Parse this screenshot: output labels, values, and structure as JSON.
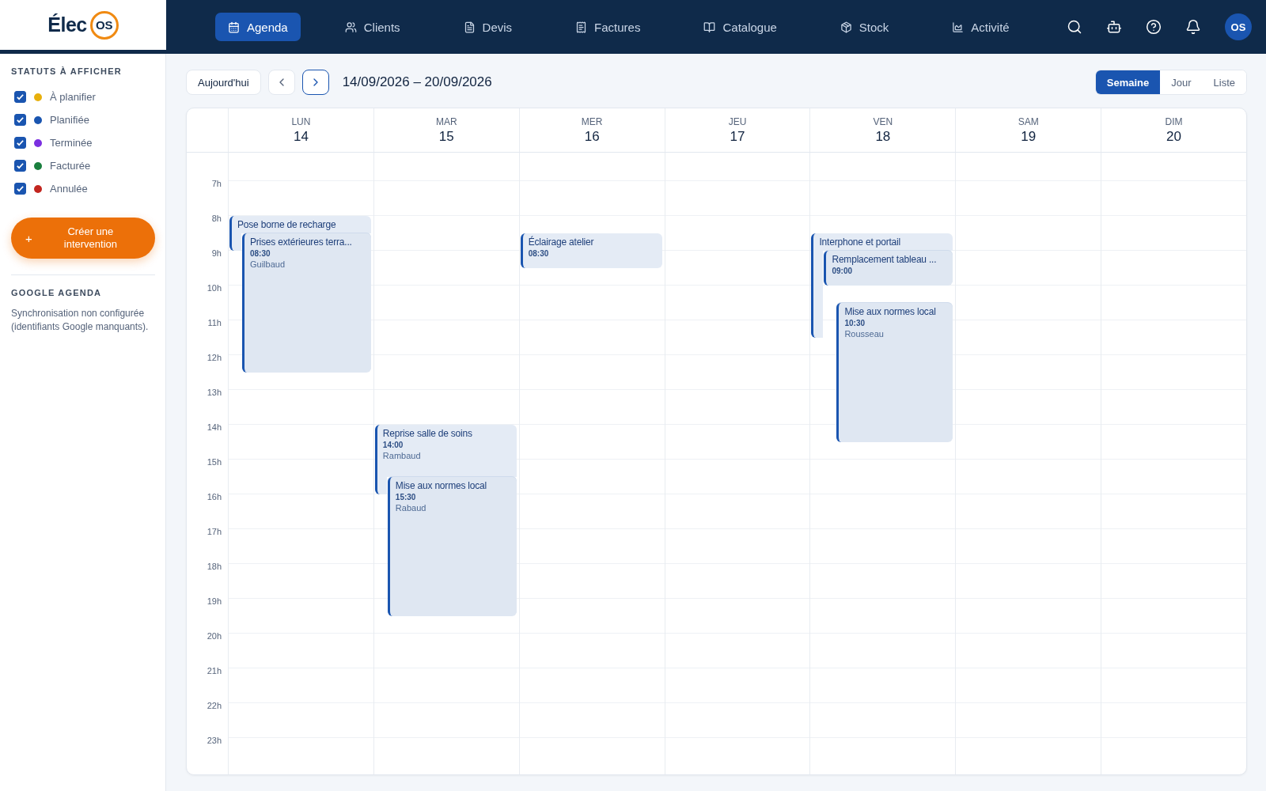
{
  "logo": {
    "text": "Élec",
    "badge": "OS"
  },
  "nav": [
    {
      "label": "Agenda",
      "selected": true
    },
    {
      "label": "Clients",
      "selected": false
    },
    {
      "label": "Devis",
      "selected": false
    },
    {
      "label": "Factures",
      "selected": false
    },
    {
      "label": "Catalogue",
      "selected": false
    },
    {
      "label": "Stock",
      "selected": false
    },
    {
      "label": "Activité",
      "selected": false
    }
  ],
  "avatar": "OS",
  "sidebar": {
    "statuses_title": "STATUTS À AFFICHER",
    "statuses": [
      {
        "label": "À planifier",
        "color": "#e8b00c",
        "checked": true
      },
      {
        "label": "Planifiée",
        "color": "#1a55b0",
        "checked": true
      },
      {
        "label": "Terminée",
        "color": "#7b2fe0",
        "checked": true
      },
      {
        "label": "Facturée",
        "color": "#1a7f3e",
        "checked": true
      },
      {
        "label": "Annulée",
        "color": "#c2261f",
        "checked": true
      }
    ],
    "create_button": {
      "icon": "+",
      "label": "Créer une intervention"
    },
    "google_title": "GOOGLE AGENDA",
    "google_text": "Synchronisation non configurée (identifiants Google manquants)."
  },
  "toolbar": {
    "today": "Aujourd'hui",
    "range": "14/09/2026 – 20/09/2026",
    "views": [
      {
        "label": "Semaine",
        "selected": true
      },
      {
        "label": "Jour",
        "selected": false
      },
      {
        "label": "Liste",
        "selected": false
      }
    ]
  },
  "calendar": {
    "hours": [
      "7h",
      "8h",
      "9h",
      "10h",
      "11h",
      "12h",
      "13h",
      "14h",
      "15h",
      "16h",
      "17h",
      "18h",
      "19h",
      "20h",
      "21h",
      "22h",
      "23h"
    ],
    "days": [
      {
        "name": "LUN",
        "date": "14",
        "events": [
          {
            "title": "Pose borne de recharge"
          },
          {
            "title": "Prises extérieures terra...",
            "time": "08:30",
            "person": "Guilbaud"
          }
        ]
      },
      {
        "name": "MAR",
        "date": "15",
        "events": [
          {
            "title": "Reprise salle de soins",
            "time": "14:00",
            "person": "Rambaud"
          },
          {
            "title": "Mise aux normes local",
            "time": "15:30",
            "person": "Rabaud"
          }
        ]
      },
      {
        "name": "MER",
        "date": "16",
        "events": [
          {
            "title": "Éclairage atelier",
            "time": "08:30"
          }
        ]
      },
      {
        "name": "JEU",
        "date": "17"
      },
      {
        "name": "VEN",
        "date": "18",
        "events": [
          {
            "title": "Interphone et portail"
          },
          {
            "title": "Remplacement tableau ...",
            "time": "09:00"
          },
          {
            "title": "Mise aux normes local",
            "time": "10:30",
            "person": "Rousseau"
          }
        ]
      },
      {
        "name": "SAM",
        "date": "19"
      },
      {
        "name": "DIM",
        "date": "20"
      }
    ]
  }
}
